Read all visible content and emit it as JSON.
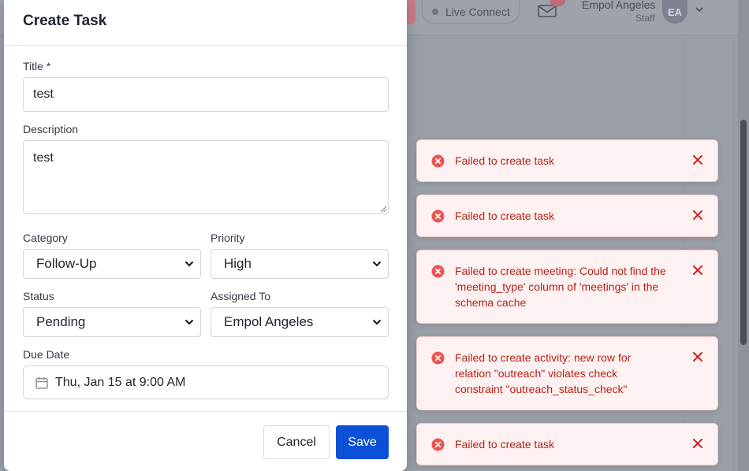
{
  "header": {
    "live_connect_label": "Live Connect",
    "user_name": "Empol Angeles",
    "user_role": "Staff",
    "avatar_initials": "EA"
  },
  "modal": {
    "title": "Create Task",
    "fields": {
      "title_label": "Title *",
      "title_value": "test",
      "description_label": "Description",
      "description_value": "test",
      "category_label": "Category",
      "category_value": "Follow-Up",
      "priority_label": "Priority",
      "priority_value": "High",
      "status_label": "Status",
      "status_value": "Pending",
      "assigned_label": "Assigned To",
      "assigned_value": "Empol Angeles",
      "due_label": "Due Date",
      "due_value": "Thu, Jan 15 at 9:00 AM"
    },
    "cancel_label": "Cancel",
    "save_label": "Save"
  },
  "toasts": [
    {
      "message": "Failed to create task"
    },
    {
      "message": "Failed to create task"
    },
    {
      "message": "Failed to create meeting: Could not find the 'meeting_type' column of 'meetings' in the schema cache"
    },
    {
      "message": "Failed to create activity: new row for relation \"outreach\" violates check constraint \"outreach_status_check\""
    },
    {
      "message": "Failed to create task"
    }
  ],
  "colors": {
    "accent": "#0b50d6",
    "error_text": "#b42318",
    "error_bg": "#fef1f1",
    "error_icon": "#ef5350"
  }
}
